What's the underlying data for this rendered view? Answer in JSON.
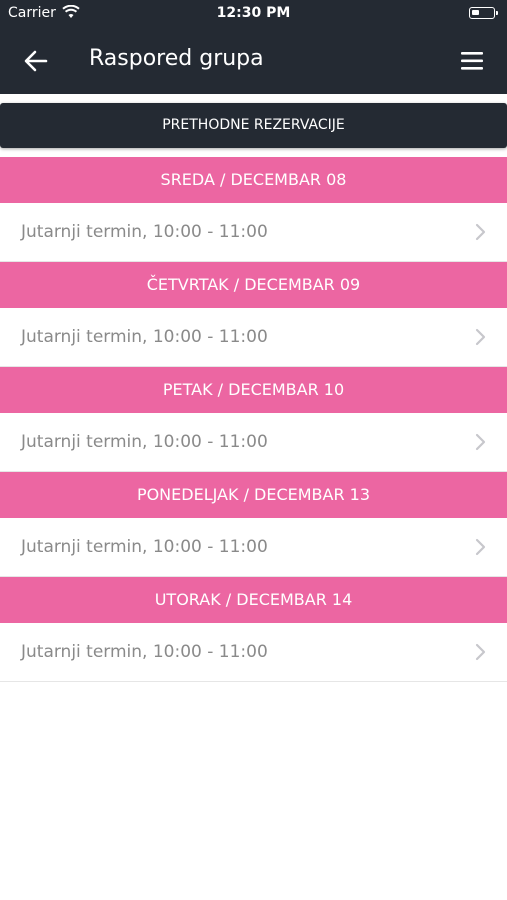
{
  "status_bar": {
    "carrier": "Carrier",
    "time": "12:30 PM",
    "wifi_icon": "wifi-icon",
    "battery_icon": "battery-icon",
    "battery_level": 0.35
  },
  "nav": {
    "title": "Raspored grupa",
    "back_icon": "arrow-left-icon",
    "menu_icon": "hamburger-menu-icon"
  },
  "previous_reservations": {
    "label": "PRETHODNE REZERVACIJE"
  },
  "days": [
    {
      "header": "SREDA / DECEMBAR 08",
      "slots": [
        {
          "label": "Jutarnji termin, 10:00 - 11:00"
        }
      ]
    },
    {
      "header": "ČETVRTAK / DECEMBAR 09",
      "slots": [
        {
          "label": "Jutarnji termin, 10:00 - 11:00"
        }
      ]
    },
    {
      "header": "PETAK / DECEMBAR 10",
      "slots": [
        {
          "label": "Jutarnji termin, 10:00 - 11:00"
        }
      ]
    },
    {
      "header": "PONEDELJAK / DECEMBAR 13",
      "slots": [
        {
          "label": "Jutarnji termin, 10:00 - 11:00"
        }
      ]
    },
    {
      "header": "UTORAK / DECEMBAR 14",
      "slots": [
        {
          "label": "Jutarnji termin, 10:00 - 11:00"
        }
      ]
    }
  ],
  "colors": {
    "header_bg": "#242a33",
    "day_header_bg": "#ec66a2",
    "slot_text": "#8a8a8a",
    "chevron": "#c7c7cc"
  }
}
